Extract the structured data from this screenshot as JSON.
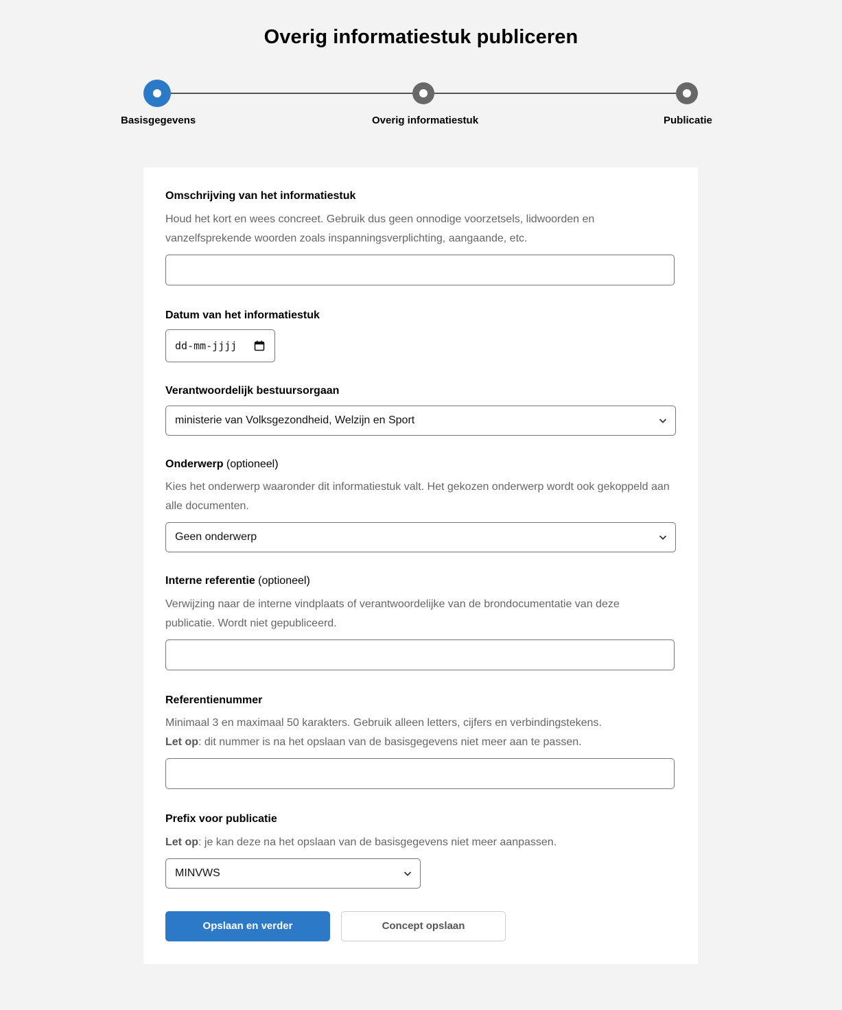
{
  "page": {
    "title": "Overig informatiestuk publiceren"
  },
  "stepper": {
    "steps": [
      {
        "label": "Basisgegevens",
        "state": "active"
      },
      {
        "label": "Overig informatiestuk",
        "state": "pending"
      },
      {
        "label": "Publicatie",
        "state": "pending"
      }
    ]
  },
  "form": {
    "description": {
      "label": "Omschrijving van het informatiestuk",
      "help": "Houd het kort en wees concreet. Gebruik dus geen onnodige voorzetsels, lidwoorden en vanzelfsprekende woorden zoals inspanningsverplichting, aangaande, etc.",
      "value": ""
    },
    "date": {
      "label": "Datum van het informatiestuk",
      "placeholder": "dd-mm-jjjj"
    },
    "organ": {
      "label": "Verantwoordelijk bestuursorgaan",
      "selected": "ministerie van Volksgezondheid, Welzijn en Sport"
    },
    "subject": {
      "label": "Onderwerp",
      "optional": "(optioneel)",
      "help": "Kies het onderwerp waaronder dit informatiestuk valt. Het gekozen onderwerp wordt ook gekoppeld aan alle documenten.",
      "selected": "Geen onderwerp"
    },
    "internal_reference": {
      "label": "Interne referentie",
      "optional": "(optioneel)",
      "help": "Verwijzing naar de interne vindplaats of verantwoordelijke van de brondocumentatie van deze publicatie. Wordt niet gepubliceerd.",
      "value": ""
    },
    "reference_number": {
      "label": "Referentienummer",
      "help": "Minimaal 3 en maximaal 50 karakters. Gebruik alleen letters, cijfers en verbindingstekens.",
      "note_bold": "Let op",
      "note": ": dit nummer is na het opslaan van de basisgegevens niet meer aan te passen.",
      "value": ""
    },
    "prefix": {
      "label": "Prefix voor publicatie",
      "note_bold": "Let op",
      "note": ": je kan deze na het opslaan van de basisgegevens niet meer aanpassen.",
      "selected": "MINVWS"
    },
    "buttons": {
      "primary": "Opslaan en verder",
      "secondary": "Concept opslaan"
    }
  },
  "colors": {
    "accent": "#2b79c7",
    "background": "#f3f3f3",
    "step_inactive": "#686868"
  }
}
